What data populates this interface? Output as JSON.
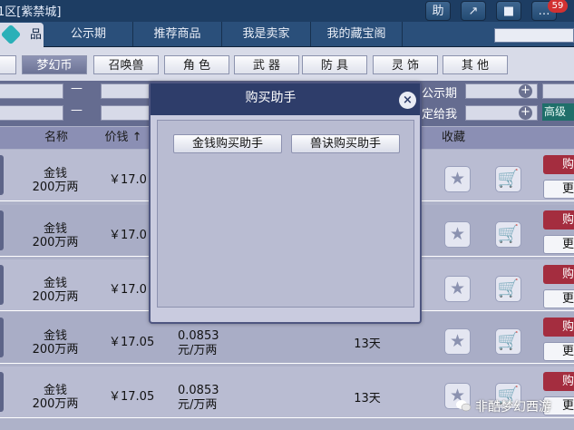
{
  "topbar": {
    "server": "1区[紫禁城]",
    "buttons": [
      {
        "label": "助",
        "icon": "helper-text-icon"
      },
      {
        "label": "↗",
        "icon": "share-icon"
      },
      {
        "label": "■",
        "icon": "stop-icon"
      },
      {
        "label": "…",
        "icon": "chat-icon"
      }
    ],
    "notification_count": "59"
  },
  "nav": {
    "active_label": "品",
    "tabs": [
      "公示期",
      "推荐商品",
      "我是卖家",
      "我的藏宝阁"
    ]
  },
  "categories": [
    "梦幻币",
    "召唤兽",
    "角 色",
    "武 器",
    "防 具",
    "灵 饰",
    "其 他"
  ],
  "active_category": "梦幻币",
  "filters": {
    "dash": "—",
    "public_period_label": "公示期",
    "assign_label": "定给我",
    "plus": "+",
    "advanced_label": "高级"
  },
  "table": {
    "headers": {
      "name": "名称",
      "price": "价钱 ↑",
      "favorite": "收藏"
    },
    "rows": [
      {
        "name": "金钱",
        "amount": "200万两",
        "price": "￥17.0",
        "unit_price": "",
        "unit": "",
        "days": "",
        "buy": "购",
        "more": "更"
      },
      {
        "name": "金钱",
        "amount": "200万两",
        "price": "￥17.0",
        "unit_price": "",
        "unit": "",
        "days": "",
        "buy": "购",
        "more": "更"
      },
      {
        "name": "金钱",
        "amount": "200万两",
        "price": "￥17.0",
        "unit_price": "",
        "unit": "",
        "days": "",
        "buy": "购",
        "more": "更"
      },
      {
        "name": "金钱",
        "amount": "200万两",
        "price": "￥17.05",
        "unit_price": "0.0853",
        "unit": "元/万两",
        "days": "13天",
        "buy": "购",
        "more": "更"
      },
      {
        "name": "金钱",
        "amount": "200万两",
        "price": "￥17.05",
        "unit_price": "0.0853",
        "unit": "元/万两",
        "days": "13天",
        "buy": "购",
        "more": "更"
      }
    ]
  },
  "modal": {
    "title": "购买助手",
    "close": "×",
    "buttons": [
      "金钱购买助手",
      "兽诀购买助手"
    ]
  },
  "watermark": "非酷梦幻西游"
}
